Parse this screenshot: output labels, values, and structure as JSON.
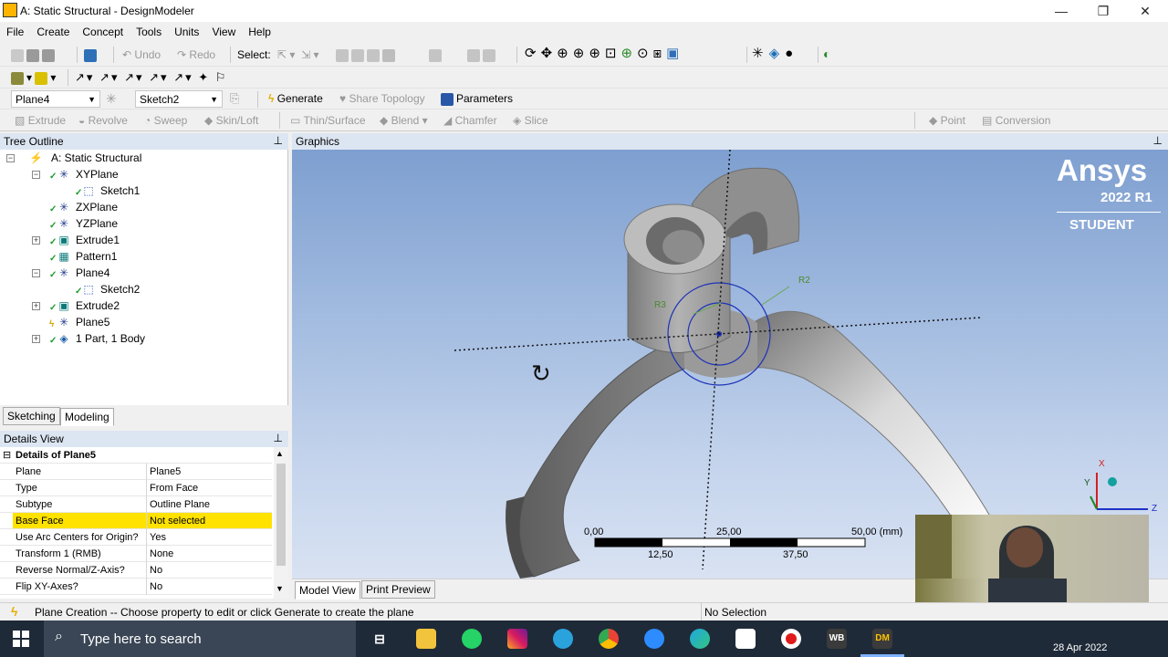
{
  "window": {
    "title": "A: Static Structural - DesignModeler",
    "minimize": "—",
    "maximize": "❐",
    "close": "✕"
  },
  "menu": [
    "File",
    "Create",
    "Concept",
    "Tools",
    "Units",
    "View",
    "Help"
  ],
  "toolbar1": {
    "undo": "Undo",
    "redo": "Redo",
    "select_label": "Select:"
  },
  "toolbar3": {
    "plane_value": "Plane4",
    "sketch_value": "Sketch2",
    "generate": "Generate",
    "share_topology": "Share Topology",
    "parameters": "Parameters"
  },
  "toolbar4": {
    "extrude": "Extrude",
    "revolve": "Revolve",
    "sweep": "Sweep",
    "skin_loft": "Skin/Loft",
    "thin_surface": "Thin/Surface",
    "blend": "Blend",
    "chamfer": "Chamfer",
    "slice": "Slice",
    "point": "Point",
    "conversion": "Conversion"
  },
  "tree": {
    "header": "Tree Outline",
    "items": [
      {
        "label": "A: Static Structural"
      },
      {
        "label": "XYPlane"
      },
      {
        "label": "Sketch1"
      },
      {
        "label": "ZXPlane"
      },
      {
        "label": "YZPlane"
      },
      {
        "label": "Extrude1"
      },
      {
        "label": "Pattern1"
      },
      {
        "label": "Plane4"
      },
      {
        "label": "Sketch2"
      },
      {
        "label": "Extrude2"
      },
      {
        "label": "Plane5"
      },
      {
        "label": "1 Part, 1 Body"
      }
    ]
  },
  "tabs": {
    "sketching": "Sketching",
    "modeling": "Modeling"
  },
  "details": {
    "header": "Details View",
    "group": "Details of Plane5",
    "rows": [
      {
        "label": "Plane",
        "value": "Plane5"
      },
      {
        "label": "Type",
        "value": "From Face"
      },
      {
        "label": "Subtype",
        "value": "Outline Plane"
      },
      {
        "label": "Base Face",
        "value": "Not selected"
      },
      {
        "label": "Use Arc Centers for Origin?",
        "value": "Yes"
      },
      {
        "label": "Transform 1 (RMB)",
        "value": "None"
      },
      {
        "label": "Reverse Normal/Z-Axis?",
        "value": "No"
      },
      {
        "label": "Flip XY-Axes?",
        "value": "No"
      }
    ]
  },
  "graphics": {
    "header": "Graphics",
    "brand": "Ansys",
    "version": "2022 R1",
    "edition": "STUDENT",
    "dim_r2": "R2",
    "dim_r3": "R3",
    "scale_labels": {
      "t0": "0,00",
      "t25": "25,00",
      "t50": "50,00 (mm)",
      "b12": "12,50",
      "b37": "37,50"
    },
    "triad": {
      "x": "X",
      "y": "Y",
      "z": "Z"
    },
    "tab_model_view": "Model View",
    "tab_print_preview": "Print Preview"
  },
  "status": {
    "message": "Plane Creation -- Choose property to edit or click Generate to create the plane",
    "selection": "No Selection"
  },
  "taskbar": {
    "search_placeholder": "Type here to search",
    "date": "28 Apr 2022",
    "wb": "WB",
    "dm": "DM"
  },
  "colors": {
    "accent_blue": "#1e42a8",
    "highlight": "#ffe200",
    "panel_header": "#dce6f2"
  }
}
